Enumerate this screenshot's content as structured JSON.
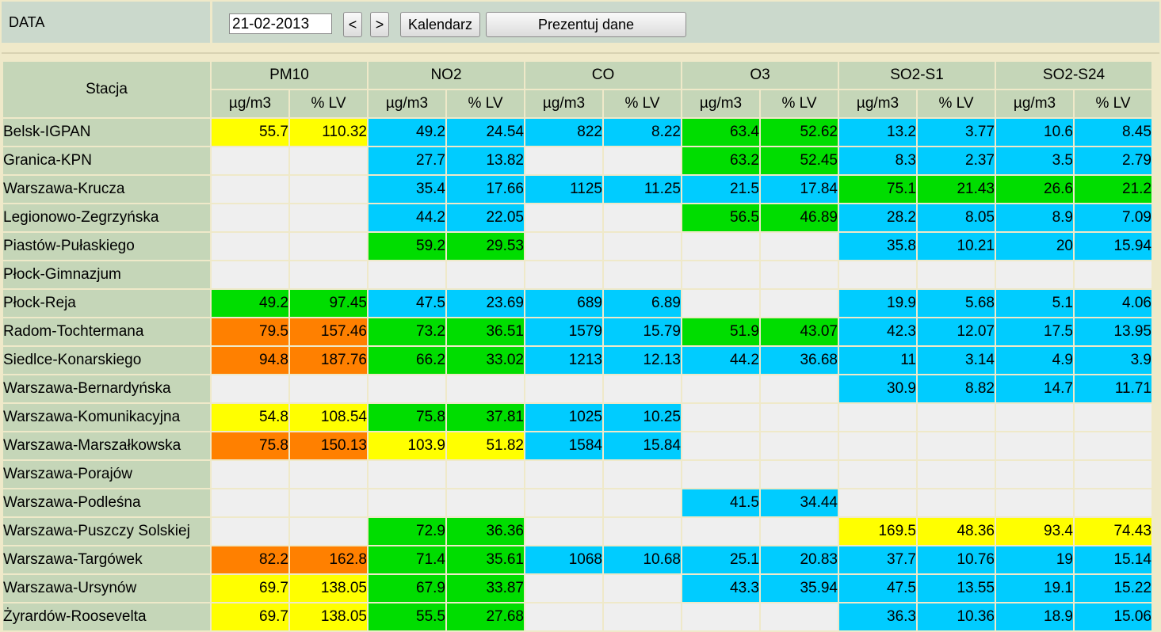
{
  "header": {
    "data_label": "DATA",
    "date_value": "21-02-2013",
    "prev_label": "<",
    "next_label": ">",
    "calendar_label": "Kalendarz",
    "show_label": "Prezentuj dane"
  },
  "table": {
    "station_header": "Stacja",
    "pollutants": [
      "PM10",
      "NO2",
      "CO",
      "O3",
      "SO2-S1",
      "SO2-S24"
    ],
    "unit_labels": [
      "µg/m3",
      "% LV"
    ],
    "colors": {
      "e": "#efefef",
      "y": "#ffff00",
      "g": "#00dd00",
      "b": "#00ccff",
      "o": "#ff8000"
    },
    "rows": [
      {
        "station": "Belsk-IGPAN",
        "cells": [
          [
            "55.7",
            "y"
          ],
          [
            "110.32",
            "y"
          ],
          [
            "49.2",
            "b"
          ],
          [
            "24.54",
            "b"
          ],
          [
            "822",
            "b"
          ],
          [
            "8.22",
            "b"
          ],
          [
            "63.4",
            "g"
          ],
          [
            "52.62",
            "g"
          ],
          [
            "13.2",
            "b"
          ],
          [
            "3.77",
            "b"
          ],
          [
            "10.6",
            "b"
          ],
          [
            "8.45",
            "b"
          ]
        ]
      },
      {
        "station": "Granica-KPN",
        "cells": [
          [
            "",
            "e"
          ],
          [
            "",
            "e"
          ],
          [
            "27.7",
            "b"
          ],
          [
            "13.82",
            "b"
          ],
          [
            "",
            "e"
          ],
          [
            "",
            "e"
          ],
          [
            "63.2",
            "g"
          ],
          [
            "52.45",
            "g"
          ],
          [
            "8.3",
            "b"
          ],
          [
            "2.37",
            "b"
          ],
          [
            "3.5",
            "b"
          ],
          [
            "2.79",
            "b"
          ]
        ]
      },
      {
        "station": "Warszawa-Krucza",
        "cells": [
          [
            "",
            "e"
          ],
          [
            "",
            "e"
          ],
          [
            "35.4",
            "b"
          ],
          [
            "17.66",
            "b"
          ],
          [
            "1125",
            "b"
          ],
          [
            "11.25",
            "b"
          ],
          [
            "21.5",
            "b"
          ],
          [
            "17.84",
            "b"
          ],
          [
            "75.1",
            "g"
          ],
          [
            "21.43",
            "g"
          ],
          [
            "26.6",
            "g"
          ],
          [
            "21.2",
            "g"
          ]
        ]
      },
      {
        "station": "Legionowo-Zegrzyńska",
        "cells": [
          [
            "",
            "e"
          ],
          [
            "",
            "e"
          ],
          [
            "44.2",
            "b"
          ],
          [
            "22.05",
            "b"
          ],
          [
            "",
            "e"
          ],
          [
            "",
            "e"
          ],
          [
            "56.5",
            "g"
          ],
          [
            "46.89",
            "g"
          ],
          [
            "28.2",
            "b"
          ],
          [
            "8.05",
            "b"
          ],
          [
            "8.9",
            "b"
          ],
          [
            "7.09",
            "b"
          ]
        ]
      },
      {
        "station": "Piastów-Pułaskiego",
        "cells": [
          [
            "",
            "e"
          ],
          [
            "",
            "e"
          ],
          [
            "59.2",
            "g"
          ],
          [
            "29.53",
            "g"
          ],
          [
            "",
            "e"
          ],
          [
            "",
            "e"
          ],
          [
            "",
            "e"
          ],
          [
            "",
            "e"
          ],
          [
            "35.8",
            "b"
          ],
          [
            "10.21",
            "b"
          ],
          [
            "20",
            "b"
          ],
          [
            "15.94",
            "b"
          ]
        ]
      },
      {
        "station": "Płock-Gimnazjum",
        "cells": [
          [
            "",
            "e"
          ],
          [
            "",
            "e"
          ],
          [
            "",
            "e"
          ],
          [
            "",
            "e"
          ],
          [
            "",
            "e"
          ],
          [
            "",
            "e"
          ],
          [
            "",
            "e"
          ],
          [
            "",
            "e"
          ],
          [
            "",
            "e"
          ],
          [
            "",
            "e"
          ],
          [
            "",
            "e"
          ],
          [
            "",
            "e"
          ]
        ]
      },
      {
        "station": "Płock-Reja",
        "cells": [
          [
            "49.2",
            "g"
          ],
          [
            "97.45",
            "g"
          ],
          [
            "47.5",
            "b"
          ],
          [
            "23.69",
            "b"
          ],
          [
            "689",
            "b"
          ],
          [
            "6.89",
            "b"
          ],
          [
            "",
            "e"
          ],
          [
            "",
            "e"
          ],
          [
            "19.9",
            "b"
          ],
          [
            "5.68",
            "b"
          ],
          [
            "5.1",
            "b"
          ],
          [
            "4.06",
            "b"
          ]
        ]
      },
      {
        "station": "Radom-Tochtermana",
        "cells": [
          [
            "79.5",
            "o"
          ],
          [
            "157.46",
            "o"
          ],
          [
            "73.2",
            "g"
          ],
          [
            "36.51",
            "g"
          ],
          [
            "1579",
            "b"
          ],
          [
            "15.79",
            "b"
          ],
          [
            "51.9",
            "g"
          ],
          [
            "43.07",
            "g"
          ],
          [
            "42.3",
            "b"
          ],
          [
            "12.07",
            "b"
          ],
          [
            "17.5",
            "b"
          ],
          [
            "13.95",
            "b"
          ]
        ]
      },
      {
        "station": "Siedlce-Konarskiego",
        "cells": [
          [
            "94.8",
            "o"
          ],
          [
            "187.76",
            "o"
          ],
          [
            "66.2",
            "g"
          ],
          [
            "33.02",
            "g"
          ],
          [
            "1213",
            "b"
          ],
          [
            "12.13",
            "b"
          ],
          [
            "44.2",
            "b"
          ],
          [
            "36.68",
            "b"
          ],
          [
            "11",
            "b"
          ],
          [
            "3.14",
            "b"
          ],
          [
            "4.9",
            "b"
          ],
          [
            "3.9",
            "b"
          ]
        ]
      },
      {
        "station": "Warszawa-Bernardyńska",
        "cells": [
          [
            "",
            "e"
          ],
          [
            "",
            "e"
          ],
          [
            "",
            "e"
          ],
          [
            "",
            "e"
          ],
          [
            "",
            "e"
          ],
          [
            "",
            "e"
          ],
          [
            "",
            "e"
          ],
          [
            "",
            "e"
          ],
          [
            "30.9",
            "b"
          ],
          [
            "8.82",
            "b"
          ],
          [
            "14.7",
            "b"
          ],
          [
            "11.71",
            "b"
          ]
        ]
      },
      {
        "station": "Warszawa-Komunikacyjna",
        "cells": [
          [
            "54.8",
            "y"
          ],
          [
            "108.54",
            "y"
          ],
          [
            "75.8",
            "g"
          ],
          [
            "37.81",
            "g"
          ],
          [
            "1025",
            "b"
          ],
          [
            "10.25",
            "b"
          ],
          [
            "",
            "e"
          ],
          [
            "",
            "e"
          ],
          [
            "",
            "e"
          ],
          [
            "",
            "e"
          ],
          [
            "",
            "e"
          ],
          [
            "",
            "e"
          ]
        ]
      },
      {
        "station": "Warszawa-Marszałkowska",
        "cells": [
          [
            "75.8",
            "o"
          ],
          [
            "150.13",
            "o"
          ],
          [
            "103.9",
            "y"
          ],
          [
            "51.82",
            "y"
          ],
          [
            "1584",
            "b"
          ],
          [
            "15.84",
            "b"
          ],
          [
            "",
            "e"
          ],
          [
            "",
            "e"
          ],
          [
            "",
            "e"
          ],
          [
            "",
            "e"
          ],
          [
            "",
            "e"
          ],
          [
            "",
            "e"
          ]
        ]
      },
      {
        "station": "Warszawa-Porajów",
        "cells": [
          [
            "",
            "e"
          ],
          [
            "",
            "e"
          ],
          [
            "",
            "e"
          ],
          [
            "",
            "e"
          ],
          [
            "",
            "e"
          ],
          [
            "",
            "e"
          ],
          [
            "",
            "e"
          ],
          [
            "",
            "e"
          ],
          [
            "",
            "e"
          ],
          [
            "",
            "e"
          ],
          [
            "",
            "e"
          ],
          [
            "",
            "e"
          ]
        ]
      },
      {
        "station": "Warszawa-Podleśna",
        "cells": [
          [
            "",
            "e"
          ],
          [
            "",
            "e"
          ],
          [
            "",
            "e"
          ],
          [
            "",
            "e"
          ],
          [
            "",
            "e"
          ],
          [
            "",
            "e"
          ],
          [
            "41.5",
            "b"
          ],
          [
            "34.44",
            "b"
          ],
          [
            "",
            "e"
          ],
          [
            "",
            "e"
          ],
          [
            "",
            "e"
          ],
          [
            "",
            "e"
          ]
        ]
      },
      {
        "station": "Warszawa-Puszczy Solskiej",
        "cells": [
          [
            "",
            "e"
          ],
          [
            "",
            "e"
          ],
          [
            "72.9",
            "g"
          ],
          [
            "36.36",
            "g"
          ],
          [
            "",
            "e"
          ],
          [
            "",
            "e"
          ],
          [
            "",
            "e"
          ],
          [
            "",
            "e"
          ],
          [
            "169.5",
            "y"
          ],
          [
            "48.36",
            "y"
          ],
          [
            "93.4",
            "y"
          ],
          [
            "74.43",
            "y"
          ]
        ]
      },
      {
        "station": "Warszawa-Targówek",
        "cells": [
          [
            "82.2",
            "o"
          ],
          [
            "162.8",
            "o"
          ],
          [
            "71.4",
            "g"
          ],
          [
            "35.61",
            "g"
          ],
          [
            "1068",
            "b"
          ],
          [
            "10.68",
            "b"
          ],
          [
            "25.1",
            "b"
          ],
          [
            "20.83",
            "b"
          ],
          [
            "37.7",
            "b"
          ],
          [
            "10.76",
            "b"
          ],
          [
            "19",
            "b"
          ],
          [
            "15.14",
            "b"
          ]
        ]
      },
      {
        "station": "Warszawa-Ursynów",
        "cells": [
          [
            "69.7",
            "y"
          ],
          [
            "138.05",
            "y"
          ],
          [
            "67.9",
            "g"
          ],
          [
            "33.87",
            "g"
          ],
          [
            "",
            "e"
          ],
          [
            "",
            "e"
          ],
          [
            "43.3",
            "b"
          ],
          [
            "35.94",
            "b"
          ],
          [
            "47.5",
            "b"
          ],
          [
            "13.55",
            "b"
          ],
          [
            "19.1",
            "b"
          ],
          [
            "15.22",
            "b"
          ]
        ]
      },
      {
        "station": "Żyrardów-Roosevelta",
        "cells": [
          [
            "69.7",
            "y"
          ],
          [
            "138.05",
            "y"
          ],
          [
            "55.5",
            "g"
          ],
          [
            "27.68",
            "g"
          ],
          [
            "",
            "e"
          ],
          [
            "",
            "e"
          ],
          [
            "",
            "e"
          ],
          [
            "",
            "e"
          ],
          [
            "36.3",
            "b"
          ],
          [
            "10.36",
            "b"
          ],
          [
            "18.9",
            "b"
          ],
          [
            "15.06",
            "b"
          ]
        ]
      }
    ]
  }
}
